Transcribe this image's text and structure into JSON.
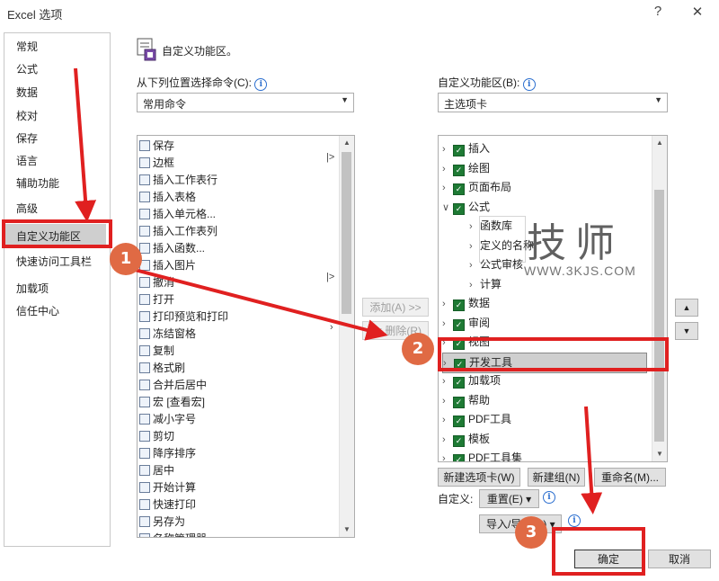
{
  "window": {
    "title": "Excel 选项",
    "help": "?",
    "close": "✕"
  },
  "sidebar": {
    "items": [
      "常规",
      "公式",
      "数据",
      "校对",
      "保存",
      "语言",
      "辅助功能",
      "高级",
      "自定义功能区",
      "快速访问工具栏",
      "加载项",
      "信任中心"
    ]
  },
  "main": {
    "section_title": "自定义功能区。",
    "choose_label": "从下列位置选择命令(C):",
    "choose_value": "常用命令",
    "customize_label": "自定义功能区(B):",
    "customize_value": "主选项卡",
    "commands": [
      "保存",
      "边框",
      "插入工作表行",
      "插入表格",
      "插入单元格...",
      "插入工作表列",
      "插入函数...",
      "插入图片",
      "撤消",
      "打开",
      "打印预览和打印",
      "冻结窗格",
      "复制",
      "格式刷",
      "合并后居中",
      "宏 [查看宏]",
      "减小字号",
      "剪切",
      "降序排序",
      "居中",
      "开始计算",
      "快速打印",
      "另存为",
      "名称管理器"
    ],
    "add_button": "添加(A) >>",
    "remove_button": "<< 删除(R)",
    "tree": [
      {
        "label": "插入",
        "checked": true
      },
      {
        "label": "绘图",
        "checked": true
      },
      {
        "label": "页面布局",
        "checked": true
      },
      {
        "label": "公式",
        "checked": true,
        "expanded": true
      },
      {
        "label": "函数库",
        "child": true
      },
      {
        "label": "定义的名称",
        "child": true
      },
      {
        "label": "公式审核",
        "child": true
      },
      {
        "label": "计算",
        "child": true
      },
      {
        "label": "数据",
        "checked": true
      },
      {
        "label": "审阅",
        "checked": true
      },
      {
        "label": "视图",
        "checked": true
      },
      {
        "label": "开发工具",
        "checked": true
      },
      {
        "label": "加载项",
        "checked": true
      },
      {
        "label": "帮助",
        "checked": true
      },
      {
        "label": "PDF工具",
        "checked": true
      },
      {
        "label": "模板",
        "checked": true
      },
      {
        "label": "PDF工具集",
        "checked": true
      }
    ],
    "new_tab_button": "新建选项卡(W)",
    "new_group_button": "新建组(N)",
    "rename_button": "重命名(M)...",
    "customize_text": "自定义:",
    "reset_button": "重置(E) ▾",
    "import_export_button": "导入/导出(P) ▾",
    "ok_button": "确定",
    "cancel_button": "取消"
  },
  "watermark": {
    "chars": [
      "技",
      "师"
    ],
    "url": "WWW.3KJS.COM"
  },
  "annotations": {
    "badges": [
      "1",
      "2",
      "3"
    ],
    "color": "#e02020",
    "badge_color": "#e06a44"
  }
}
